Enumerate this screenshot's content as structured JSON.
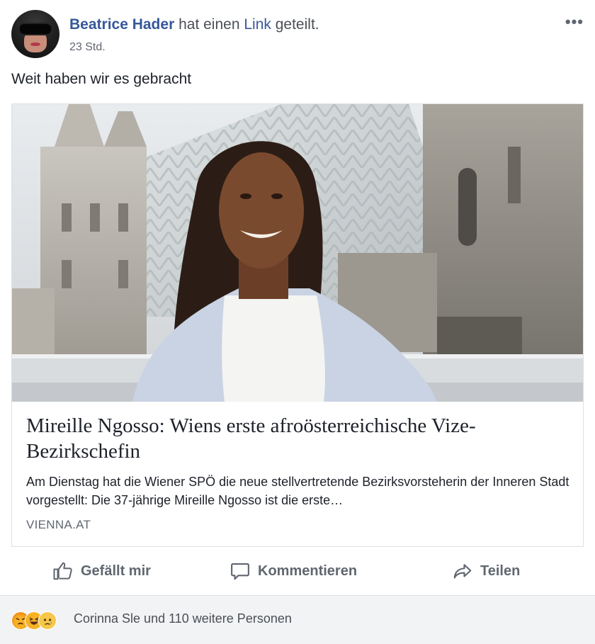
{
  "post": {
    "author": "Beatrice Hader",
    "action_pre": "hat einen",
    "action_link": "Link",
    "action_post": "geteilt.",
    "timestamp": "23 Std.",
    "more_label": "•••",
    "text": "Weit haben wir es gebracht"
  },
  "link_preview": {
    "title": "Mireille Ngosso: Wiens erste afroösterreichische Vize-Bezirkschefin",
    "description": "Am Dienstag hat die Wiener SPÖ die neue stellvertretende Bezirksvorsteherin der Inneren Stadt vorgestellt: Die 37-jährige Mireille Ngosso ist die erste…",
    "domain": "VIENNA.AT"
  },
  "actions": {
    "like_label": "Gefällt mir",
    "comment_label": "Kommentieren",
    "share_label": "Teilen"
  },
  "reactions": {
    "icons": [
      "angry-reaction-icon",
      "haha-reaction-icon",
      "sad-reaction-icon"
    ],
    "summary": "Corinna Sle und 110 weitere Personen"
  },
  "colors": {
    "link_blue": "#365899",
    "secondary_text": "#606770",
    "border": "#dddfe2",
    "footer_bg": "#f2f3f5"
  }
}
